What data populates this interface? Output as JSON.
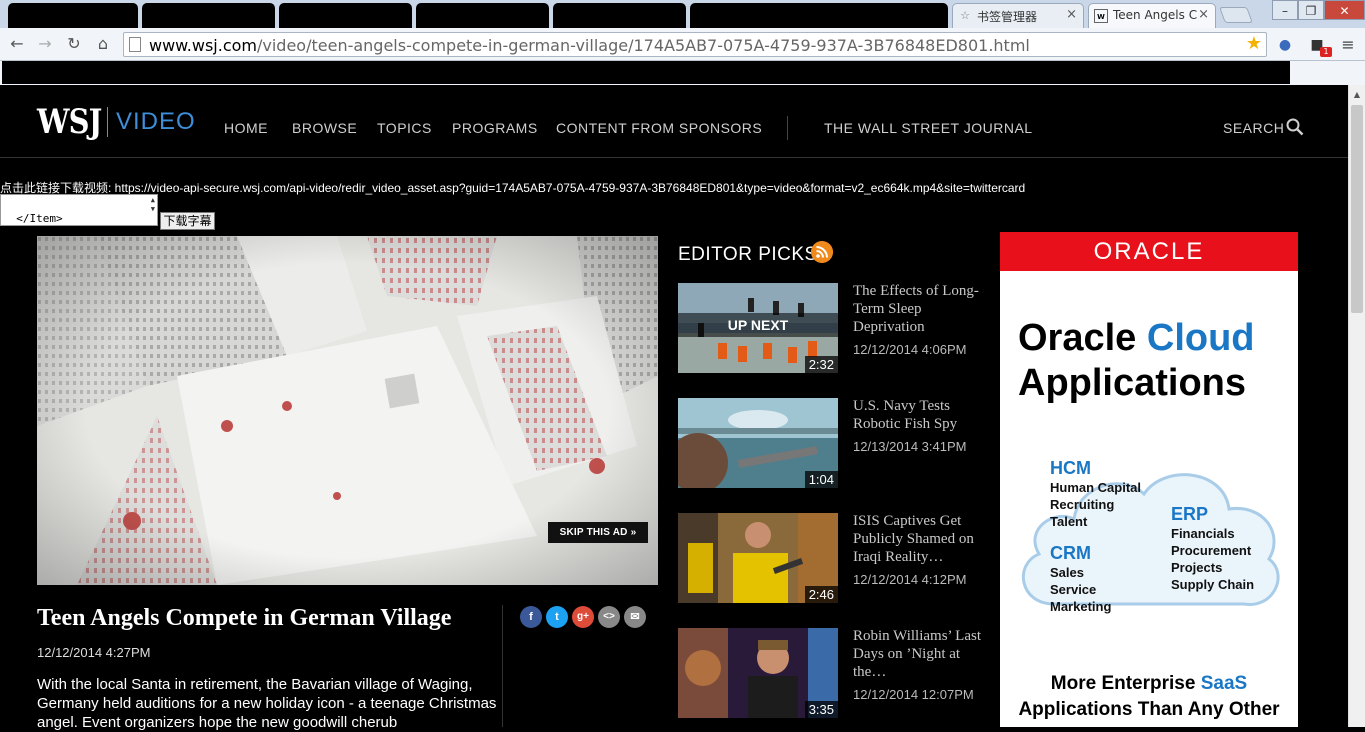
{
  "browser": {
    "tabs": [
      {
        "title": "",
        "redacted": true
      },
      {
        "title": "",
        "redacted": true
      },
      {
        "title": "",
        "redacted": true
      },
      {
        "title": "",
        "redacted": true
      },
      {
        "title": "",
        "redacted": true
      },
      {
        "title": "",
        "redacted": true
      },
      {
        "title": "书签管理器",
        "redacted": false
      },
      {
        "title": "Teen Angels C",
        "redacted": false,
        "active": true
      }
    ],
    "url_host": "www.wsj.com",
    "url_path": "/video/teen-angels-compete-in-german-village/174A5AB7-075A-4759-937A-3B76848ED801.html",
    "extension_badge": "1"
  },
  "header": {
    "logo_wsj": "WSJ",
    "logo_video": "VIDEO",
    "nav": [
      "HOME",
      "BROWSE",
      "TOPICS",
      "PROGRAMS",
      "CONTENT FROM SPONSORS"
    ],
    "wsj_link": "THE WALL STREET JOURNAL",
    "search_label": "SEARCH"
  },
  "download": {
    "line": "点击此链接下载视频: https://video-api-secure.wsj.com/api-video/redir_video_asset.asp?guid=174A5AB7-075A-4759-937A-3B76848ED801&type=video&format=v2_ec664k.mp4&site=twittercard",
    "subtitle_text": "</Item>\n</Subtitle>",
    "subtitle_button": "下载字幕"
  },
  "video": {
    "skip_ad": "SKIP THIS AD »",
    "title": "Teen Angels Compete in German Village",
    "date": "12/12/2014 4:27PM",
    "description": "With the local Santa in retirement, the Bavarian village of Waging, Germany held auditions for a new holiday icon - a teenage Christmas angel. Event organizers hope the new goodwill cherub"
  },
  "share": [
    {
      "name": "facebook-icon",
      "glyph": "f",
      "color": "#3b5998"
    },
    {
      "name": "twitter-icon",
      "glyph": "t",
      "color": "#1da1f2"
    },
    {
      "name": "google-plus-icon",
      "glyph": "g+",
      "color": "#dd4b39"
    },
    {
      "name": "embed-icon",
      "glyph": "<>",
      "color": "#888888"
    },
    {
      "name": "email-icon",
      "glyph": "✉",
      "color": "#888888"
    }
  ],
  "editor_picks": {
    "heading": "EDITOR PICKS",
    "items": [
      {
        "title": "The Effects of Long-Term Sleep Deprivation",
        "date": "12/12/2014 4:06PM",
        "duration": "2:32",
        "overlay": "UP NEXT"
      },
      {
        "title": "U.S. Navy Tests Robotic Fish Spy",
        "date": "12/13/2014 3:41PM",
        "duration": "1:04",
        "overlay": ""
      },
      {
        "title": "ISIS Captives Get Publicly Shamed on Iraqi Reality…",
        "date": "12/12/2014 4:12PM",
        "duration": "2:46",
        "overlay": ""
      },
      {
        "title": "Robin Williams’ Last Days on ’Night at the…",
        "date": "12/12/2014 12:07PM",
        "duration": "3:35",
        "overlay": ""
      }
    ]
  },
  "ad": {
    "brand": "ORACLE",
    "headline_1": "Oracle",
    "headline_1b": "Cloud",
    "headline_2": "Applications",
    "hcm": "HCM",
    "hcm_items": [
      "Human Capital",
      "Recruiting",
      "Talent"
    ],
    "crm": "CRM",
    "crm_items": [
      "Sales",
      "Service",
      "Marketing"
    ],
    "erp": "ERP",
    "erp_items": [
      "Financials",
      "Procurement",
      "Projects",
      "Supply Chain"
    ],
    "footer_1a": "More Enterprise",
    "footer_1b": "SaaS",
    "footer_2": "Applications Than Any Other"
  }
}
